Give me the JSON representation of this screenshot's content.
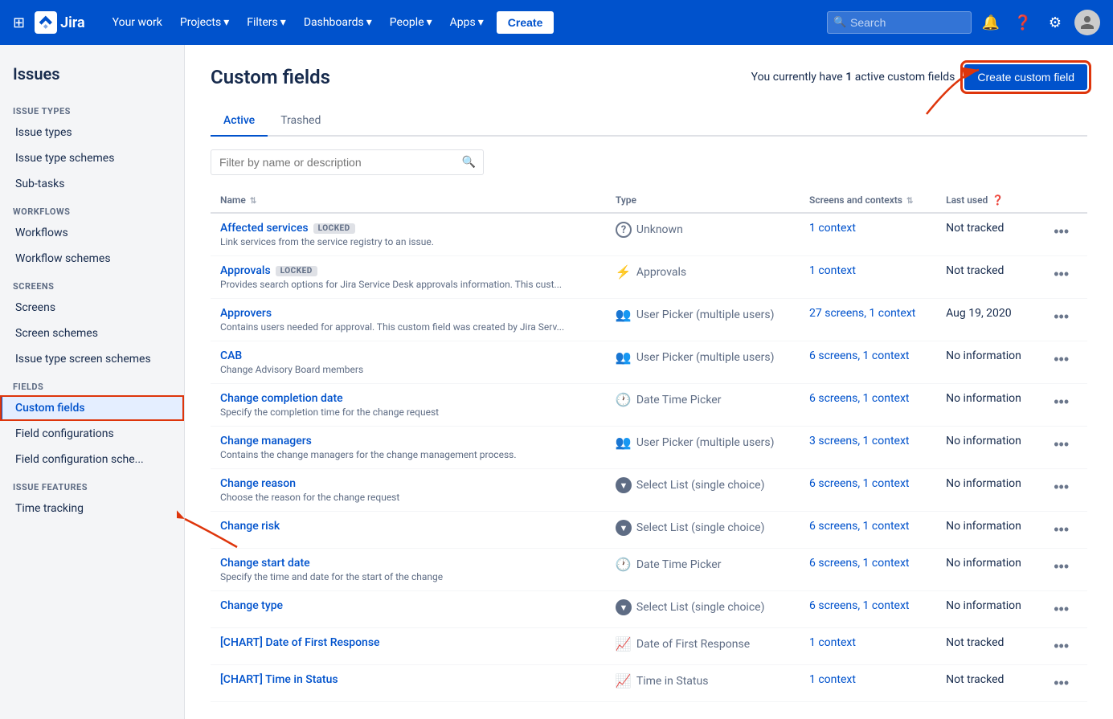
{
  "topnav": {
    "logo_text": "Jira",
    "your_work": "Your work",
    "projects": "Projects",
    "filters": "Filters",
    "dashboards": "Dashboards",
    "people": "People",
    "apps": "Apps",
    "create": "Create",
    "search_placeholder": "Search"
  },
  "sidebar": {
    "top_label": "Issues",
    "sections": [
      {
        "title": "ISSUE TYPES",
        "items": [
          {
            "label": "Issue types",
            "active": false
          },
          {
            "label": "Issue type schemes",
            "active": false
          },
          {
            "label": "Sub-tasks",
            "active": false
          }
        ]
      },
      {
        "title": "WORKFLOWS",
        "items": [
          {
            "label": "Workflows",
            "active": false
          },
          {
            "label": "Workflow schemes",
            "active": false
          }
        ]
      },
      {
        "title": "SCREENS",
        "items": [
          {
            "label": "Screens",
            "active": false
          },
          {
            "label": "Screen schemes",
            "active": false
          },
          {
            "label": "Issue type screen schemes",
            "active": false
          }
        ]
      },
      {
        "title": "FIELDS",
        "items": [
          {
            "label": "Custom fields",
            "active": true
          },
          {
            "label": "Field configurations",
            "active": false
          },
          {
            "label": "Field configuration sche...",
            "active": false
          }
        ]
      },
      {
        "title": "ISSUE FEATURES",
        "items": [
          {
            "label": "Time tracking",
            "active": false
          }
        ]
      }
    ]
  },
  "page": {
    "title": "Custom fields",
    "active_fields_text": "You currently have",
    "active_fields_count": "1",
    "active_fields_suffix": "active custom fields",
    "create_btn": "Create custom field",
    "tabs": [
      {
        "label": "Active",
        "active": true
      },
      {
        "label": "Trashed",
        "active": false
      }
    ],
    "filter_placeholder": "Filter by name or description",
    "table": {
      "columns": [
        {
          "key": "name",
          "label": "Name"
        },
        {
          "key": "type",
          "label": "Type"
        },
        {
          "key": "screens",
          "label": "Screens and contexts"
        },
        {
          "key": "last_used",
          "label": "Last used"
        }
      ],
      "rows": [
        {
          "name": "Affected services",
          "locked": true,
          "desc": "Link services from the service registry to an issue.",
          "type_icon": "?",
          "type_icon_type": "question",
          "type": "Unknown",
          "screens": "1 context",
          "last_used": "Not tracked"
        },
        {
          "name": "Approvals",
          "locked": true,
          "desc": "Provides search options for Jira Service Desk approvals information. This cust...",
          "type_icon": "⚡",
          "type_icon_type": "bolt",
          "type": "Approvals",
          "screens": "1 context",
          "last_used": "Not tracked"
        },
        {
          "name": "Approvers",
          "locked": false,
          "desc": "Contains users needed for approval. This custom field was created by Jira Serv...",
          "type_icon": "👥",
          "type_icon_type": "users",
          "type": "User Picker (multiple users)",
          "screens": "27 screens, 1 context",
          "last_used": "Aug 19, 2020"
        },
        {
          "name": "CAB",
          "locked": false,
          "desc": "Change Advisory Board members",
          "type_icon": "👥",
          "type_icon_type": "users",
          "type": "User Picker (multiple users)",
          "screens": "6 screens, 1 context",
          "last_used": "No information"
        },
        {
          "name": "Change completion date",
          "locked": false,
          "desc": "Specify the completion time for the change request",
          "type_icon": "🕐",
          "type_icon_type": "clock",
          "type": "Date Time Picker",
          "screens": "6 screens, 1 context",
          "last_used": "No information"
        },
        {
          "name": "Change managers",
          "locked": false,
          "desc": "Contains the change managers for the change management process.",
          "type_icon": "👥",
          "type_icon_type": "users",
          "type": "User Picker (multiple users)",
          "screens": "3 screens, 1 context",
          "last_used": "No information"
        },
        {
          "name": "Change reason",
          "locked": false,
          "desc": "Choose the reason for the change request",
          "type_icon": "▼",
          "type_icon_type": "select",
          "type": "Select List (single choice)",
          "screens": "6 screens, 1 context",
          "last_used": "No information"
        },
        {
          "name": "Change risk",
          "locked": false,
          "desc": "",
          "type_icon": "▼",
          "type_icon_type": "select",
          "type": "Select List (single choice)",
          "screens": "6 screens, 1 context",
          "last_used": "No information"
        },
        {
          "name": "Change start date",
          "locked": false,
          "desc": "Specify the time and date for the start of the change",
          "type_icon": "🕐",
          "type_icon_type": "clock",
          "type": "Date Time Picker",
          "screens": "6 screens, 1 context",
          "last_used": "No information"
        },
        {
          "name": "Change type",
          "locked": false,
          "desc": "",
          "type_icon": "▼",
          "type_icon_type": "select",
          "type": "Select List (single choice)",
          "screens": "6 screens, 1 context",
          "last_used": "No information"
        },
        {
          "name": "[CHART] Date of First Response",
          "locked": false,
          "desc": "",
          "type_icon": "📈",
          "type_icon_type": "chart",
          "type": "Date of First Response",
          "screens": "1 context",
          "last_used": "Not tracked"
        },
        {
          "name": "[CHART] Time in Status",
          "locked": false,
          "desc": "",
          "type_icon": "📈",
          "type_icon_type": "chart",
          "type": "Time in Status",
          "screens": "1 context",
          "last_used": "Not tracked"
        }
      ]
    }
  }
}
